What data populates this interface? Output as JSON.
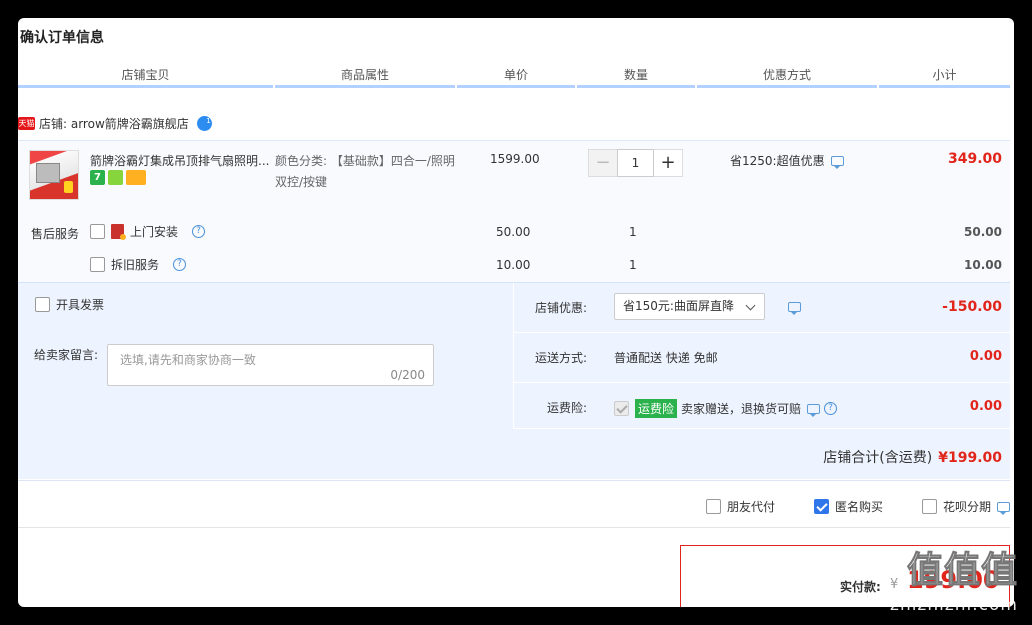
{
  "page": {
    "title": "确认订单信息"
  },
  "columns": [
    "店铺宝贝",
    "商品属性",
    "单价",
    "数量",
    "优惠方式",
    "小计"
  ],
  "shop": {
    "tag": "天猫",
    "label": "店铺: arrow箭牌浴霸旗舰店"
  },
  "item": {
    "title": "箭牌浴霸灯集成吊顶排气扇照明...",
    "badges": [
      "7",
      "",
      ""
    ],
    "sku": "颜色分类: 【基础款】四合一/照明双控/按键",
    "price": "1599.00",
    "quantity": "1",
    "qty_minus": "−",
    "qty_plus": "+",
    "promo": "省1250:超值优惠",
    "subtotal": "349.00"
  },
  "services": {
    "label": "售后服务",
    "items": [
      {
        "name": "上门安装",
        "price": "50.00",
        "qty": "1",
        "subtotal": "50.00"
      },
      {
        "name": "拆旧服务",
        "price": "10.00",
        "qty": "1",
        "subtotal": "10.00"
      }
    ]
  },
  "invoice": {
    "label": "开具发票"
  },
  "message": {
    "label": "给卖家留言:",
    "placeholder": "选填,请先和商家协商一致",
    "count": "0/200"
  },
  "store_discount": {
    "label": "店铺优惠:",
    "selected": "省150元:曲面屏直降",
    "amount": "-150.00"
  },
  "shipping": {
    "label": "运送方式:",
    "value": "普通配送 快递 免邮",
    "amount": "0.00"
  },
  "insurance": {
    "label": "运费险:",
    "tag": "运费险",
    "desc": "卖家赠送，退换货可赔",
    "amount": "0.00"
  },
  "shop_total": {
    "label": "店铺合计(含运费)",
    "amount": "¥199.00"
  },
  "options": [
    {
      "label": "朋友代付",
      "checked": false
    },
    {
      "label": "匿名购买",
      "checked": true
    },
    {
      "label": "花呗分期",
      "checked": false
    }
  ],
  "payment": {
    "label": "实付款:",
    "currency": "¥",
    "amount": "199.00"
  },
  "watermark": {
    "main": "值值值",
    "sub": "zhizhizhi.com"
  },
  "colors": {
    "accent": "#e1251b",
    "highlight": "#eef4ff",
    "primary": "#2f76ea"
  }
}
